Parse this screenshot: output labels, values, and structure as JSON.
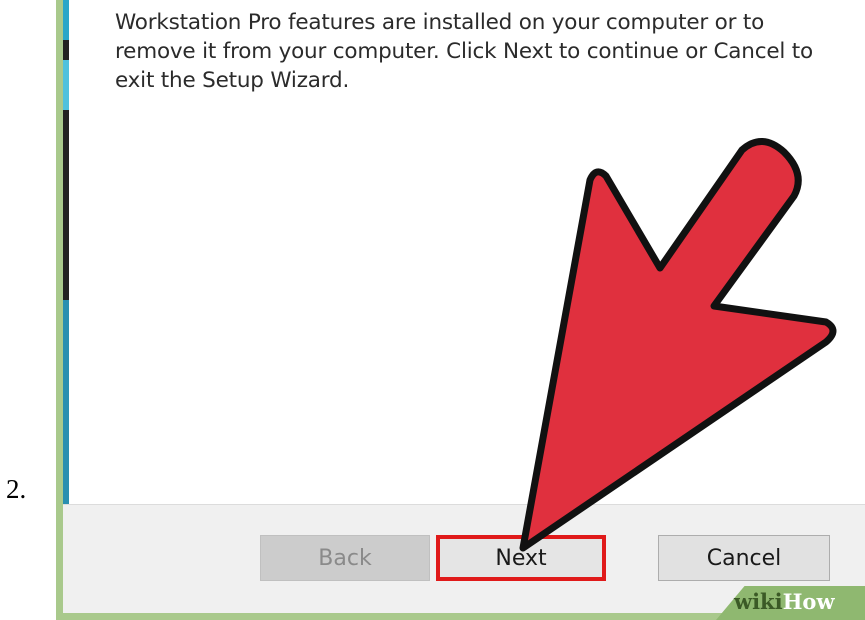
{
  "step_number": "2.",
  "description": "Workstation Pro features are installed on your computer or to remove it from your computer. Click Next to continue or Cancel to exit the Setup Wizard.",
  "buttons": {
    "back": "Back",
    "next": "Next",
    "cancel": "Cancel"
  },
  "watermark": {
    "prefix": "wiki",
    "suffix": "How"
  },
  "colors": {
    "arrow_fill": "#e0303e",
    "highlight_box": "#e01a1a",
    "frame": "#a9c98c"
  },
  "icons": {
    "pointer": "red-arrow-icon"
  }
}
